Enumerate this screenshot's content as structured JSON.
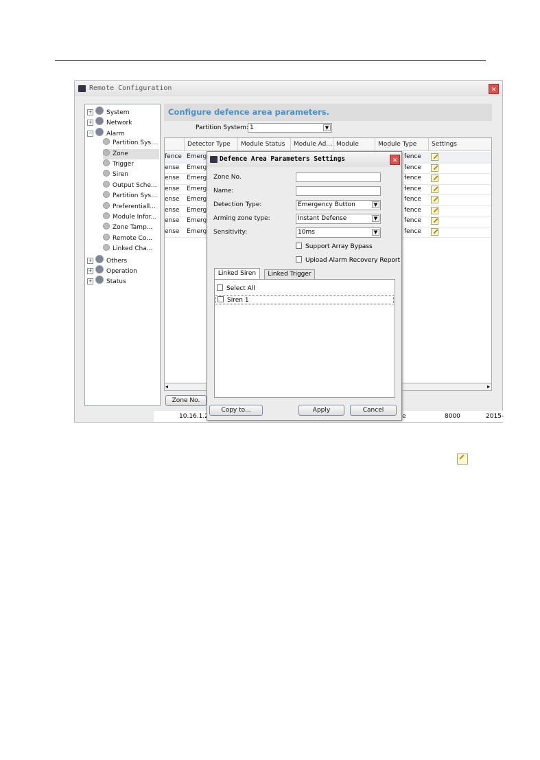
{
  "window": {
    "title": "Remote Configuration",
    "close": "✕"
  },
  "tree": [
    {
      "label": "System",
      "level": 0,
      "expander": "+"
    },
    {
      "label": "Network",
      "level": 0,
      "expander": "+"
    },
    {
      "label": "Alarm",
      "level": 0,
      "expander": "−"
    },
    {
      "label": "Partition Sys...",
      "level": 1
    },
    {
      "label": "Zone",
      "level": 1,
      "selected": true
    },
    {
      "label": "Trigger",
      "level": 1
    },
    {
      "label": "Siren",
      "level": 1
    },
    {
      "label": "Output Sche...",
      "level": 1
    },
    {
      "label": "Partition Sys...",
      "level": 1
    },
    {
      "label": "Preferentiall...",
      "level": 1
    },
    {
      "label": "Module Infor...",
      "level": 1
    },
    {
      "label": "Zone Tamp...",
      "level": 1
    },
    {
      "label": "Remote Co...",
      "level": 1
    },
    {
      "label": "Linked Cha...",
      "level": 1
    },
    {
      "label": "Others",
      "level": 0,
      "expander": "+"
    },
    {
      "label": "Operation",
      "level": 0,
      "expander": "+"
    },
    {
      "label": "Status",
      "level": 0,
      "expander": "+"
    }
  ],
  "main": {
    "header": "Configure defence area parameters.",
    "partition_label": "Partition System:",
    "partition_value": "1",
    "columns": [
      "",
      "Detector Type",
      "Module Status",
      "Module Ad...",
      "Module Ch...",
      "Module Type",
      "Settings"
    ],
    "rows": [
      [
        "fence",
        "Emerg",
        "fence"
      ],
      [
        "ense",
        "Emerg",
        "fence"
      ],
      [
        "ense",
        "Emerg",
        "fence"
      ],
      [
        "ense",
        "Emerg",
        "fence"
      ],
      [
        "ense",
        "Emerg",
        "fence"
      ],
      [
        "ense",
        "Emerg",
        "fence"
      ],
      [
        "ense",
        "Emerg",
        "fence"
      ],
      [
        "ense",
        "Emerg",
        "fence"
      ]
    ],
    "zone_no_button": "Zone No.",
    "status_row": [
      "10.16.1.2",
      "e",
      "8000",
      "2015-"
    ]
  },
  "dialog": {
    "title": "Defence Area Parameters Settings",
    "close": "✕",
    "zone_no_label": "Zone No.",
    "zone_no_value": "",
    "name_label": "Name:",
    "name_value": "",
    "detection_label": "Detection Type:",
    "detection_value": "Emergency Button",
    "arming_label": "Arming zone type:",
    "arming_value": "Instant Defense",
    "sensitivity_label": "Sensitivity:",
    "sensitivity_value": "10ms",
    "bypass_label": "Support Array Bypass",
    "recovery_label": "Upload Alarm Recovery Report",
    "tabs": [
      "Linked Siren",
      "Linked Trigger"
    ],
    "select_all": "Select All",
    "sirens": [
      "Siren 1"
    ],
    "copy_button": "Copy to...",
    "apply_button": "Apply",
    "cancel_button": "Cancel"
  },
  "colors": {
    "header_text": "#4a90c8",
    "close": "#d9534f"
  }
}
